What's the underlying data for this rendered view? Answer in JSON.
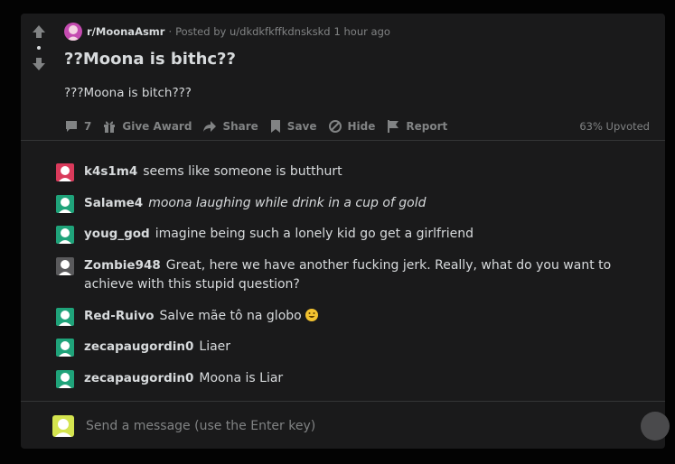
{
  "post": {
    "subreddit": "r/MoonaAsmr",
    "separator": "·",
    "posted_by": "Posted by u/dkdkfkffkdnskskd",
    "time": "1 hour ago",
    "title": "??Moona is bithc??",
    "body": "???Moona is bitch???",
    "actions": {
      "comments_count": "7",
      "give_award": "Give Award",
      "share": "Share",
      "save": "Save",
      "hide": "Hide",
      "report": "Report"
    },
    "upvoted": "63% Upvoted"
  },
  "messages": [
    {
      "user": "k4s1m4",
      "text": "seems like someone is butthurt",
      "avatar_color": "#d93a5b",
      "italic": false
    },
    {
      "user": "Salame4",
      "text": "moona laughing while drink in a cup of gold",
      "avatar_color": "#1fa37a",
      "italic": true
    },
    {
      "user": "youg_god",
      "text": "imagine being such a lonely kid go get a girlfriend",
      "avatar_color": "#1fa37a",
      "italic": false
    },
    {
      "user": "Zombie948",
      "text": "Great, here we have another fucking jerk. Really, what do you want to achieve with this stupid question?",
      "avatar_color": "#5a5a5c",
      "italic": false
    },
    {
      "user": "Red-Ruivo",
      "text": "Salve mãe tô na globo",
      "avatar_color": "#1fa37a",
      "italic": false,
      "emoji": "grinning-face"
    },
    {
      "user": "zecapaugordin0",
      "text": "Liaer",
      "avatar_color": "#1fa37a",
      "italic": false
    },
    {
      "user": "zecapaugordin0",
      "text": "Moona is Liar",
      "avatar_color": "#1fa37a",
      "italic": false
    }
  ],
  "composer": {
    "placeholder": "Send a message (use the Enter key)"
  },
  "colors": {
    "background": "#030303",
    "panel": "#1a1a1b",
    "text": "#d7dadc",
    "muted": "#818384"
  }
}
